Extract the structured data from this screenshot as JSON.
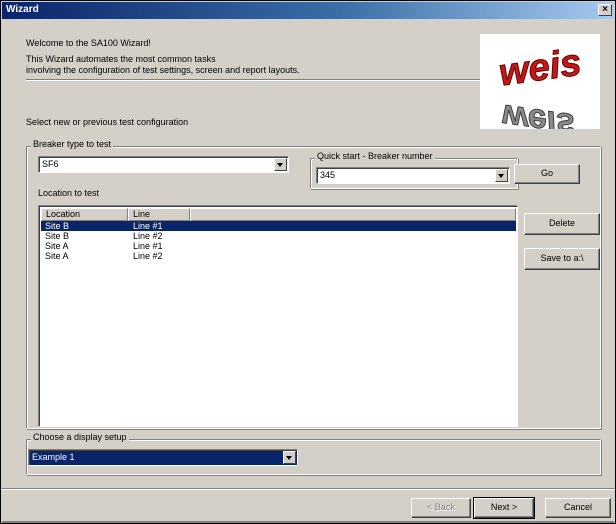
{
  "window": {
    "title": "Wizard",
    "close_glyph": "×"
  },
  "intro": {
    "welcome": "Welcome to the SA100 Wizard!",
    "line1": "This Wizard automates the most common tasks",
    "line2": "involving the configuration of test settings, screen and report layouts."
  },
  "logo": {
    "top": "WEIS",
    "bottom": "WEIS",
    "description": "weis-logo"
  },
  "select_prompt": "Select new or previous test configuration",
  "breaker_group": {
    "legend": "Breaker type to test",
    "breaker_type_value": "SF6",
    "quick_start_legend": "Quick start - Breaker number",
    "quick_start_value": "345",
    "go_label": "Go",
    "location_label": "Location to test"
  },
  "location_list": {
    "columns": [
      "Location",
      "Line"
    ],
    "rows": [
      {
        "location": "Site B",
        "line": "Line #1",
        "selected": true
      },
      {
        "location": "Site B",
        "line": "Line #2",
        "selected": false
      },
      {
        "location": "Site A",
        "line": "Line #1",
        "selected": false
      },
      {
        "location": "Site A",
        "line": "Line #2",
        "selected": false
      }
    ]
  },
  "side_buttons": {
    "delete": "Delete",
    "save": "Save to a:\\"
  },
  "display_group": {
    "legend": "Choose a display setup",
    "value": "Example 1"
  },
  "footer": {
    "back": "< Back",
    "next": "Next >",
    "cancel": "Cancel"
  },
  "colors": {
    "face": "#d4d0c8",
    "title_start": "#0a246a",
    "title_end": "#a6caf0",
    "selection": "#0a246a"
  }
}
